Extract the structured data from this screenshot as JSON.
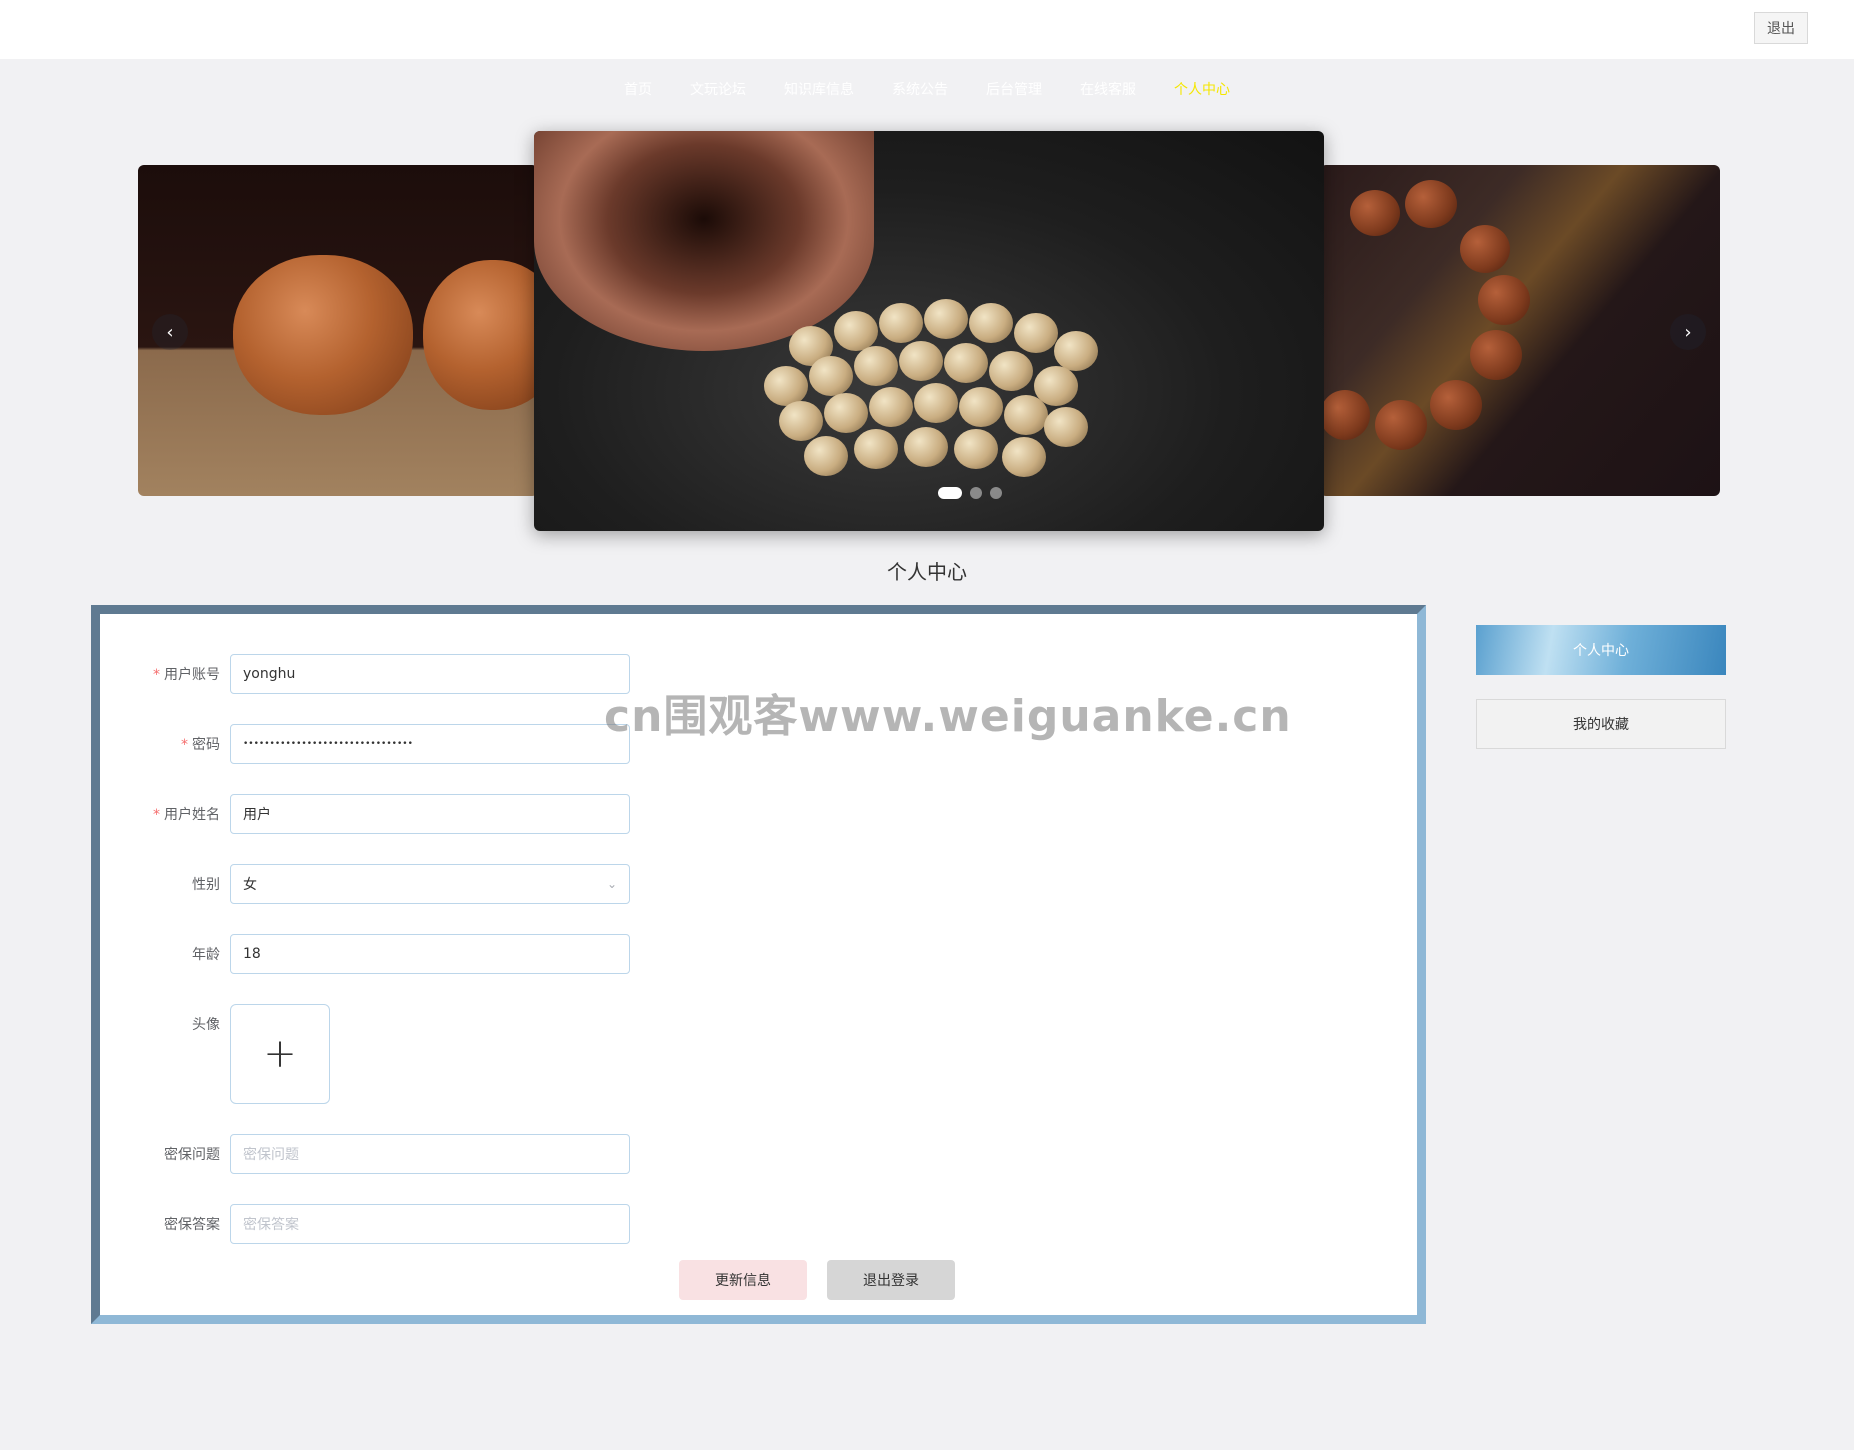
{
  "header": {
    "logout_label": "退出"
  },
  "nav": {
    "items": [
      "首页",
      "文玩论坛",
      "知识库信息",
      "系统公告",
      "后台管理",
      "在线客服",
      "个人中心"
    ],
    "active_index": 6,
    "active_color": "#f5e700"
  },
  "carousel": {
    "slide_count": 3,
    "active_index": 0,
    "prev_icon": "chevron-left-icon",
    "next_icon": "chevron-right-icon"
  },
  "page": {
    "title": "个人中心"
  },
  "form": {
    "username": {
      "label": "用户账号",
      "value": "yonghu",
      "required": true
    },
    "password": {
      "label": "密码",
      "value": "••••••••••••••••••••••••••••••••",
      "required": true
    },
    "realname": {
      "label": "用户姓名",
      "value": "用户",
      "required": true
    },
    "gender": {
      "label": "性别",
      "value": "女"
    },
    "age": {
      "label": "年龄",
      "value": "18"
    },
    "avatar": {
      "label": "头像",
      "icon": "plus-icon",
      "glyph": "+"
    },
    "security_question": {
      "label": "密保问题",
      "placeholder": "密保问题"
    },
    "security_answer": {
      "label": "密保答案",
      "placeholder": "密保答案"
    },
    "update_label": "更新信息",
    "logout_label": "退出登录"
  },
  "sidebar": {
    "items": [
      "个人中心",
      "我的收藏"
    ],
    "active_index": 0
  },
  "watermark": {
    "text": "cn围观客www.weiguanke.cn"
  },
  "colors": {
    "accent": "#5aa0cf",
    "panel_border_dark": "#5f7a91",
    "panel_border_light": "#8fb8d6",
    "required": "#f56c6c"
  }
}
